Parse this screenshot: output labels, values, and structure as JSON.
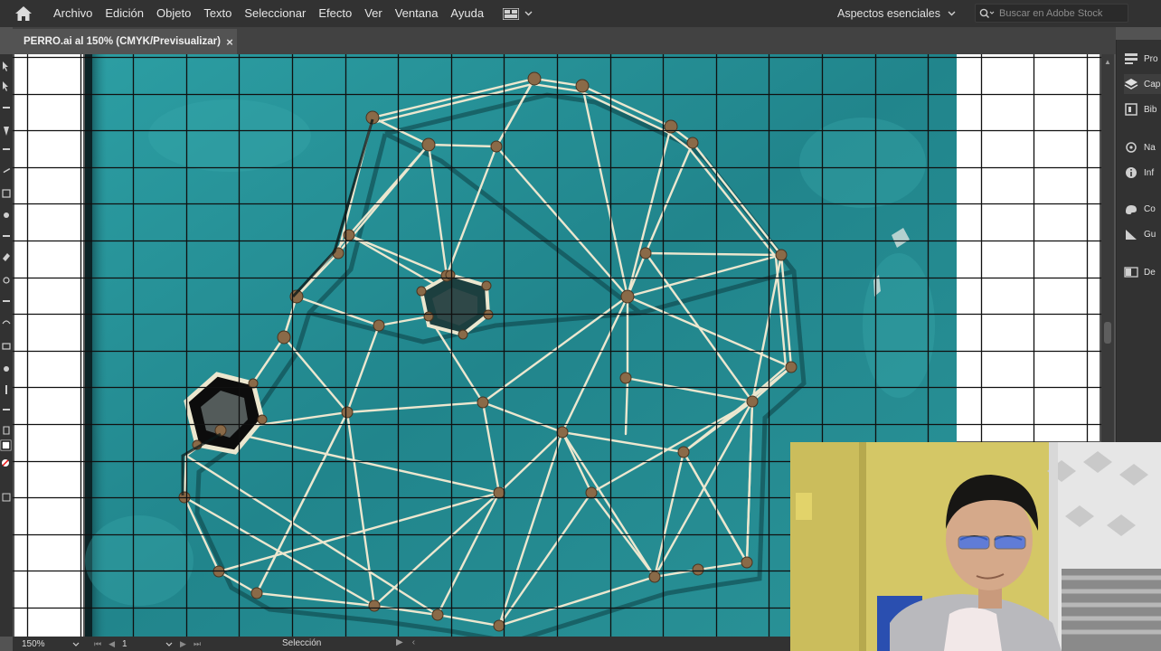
{
  "menubar": {
    "items": [
      "Archivo",
      "Edición",
      "Objeto",
      "Texto",
      "Seleccionar",
      "Efecto",
      "Ver",
      "Ventana",
      "Ayuda"
    ],
    "workspace": "Aspectos esenciales",
    "search_placeholder": "Buscar en Adobe Stock"
  },
  "document": {
    "tab_title": "PERRO.ai al 150% (CMYK/Previsualizar)",
    "close_glyph": "×"
  },
  "right_panel": {
    "items": [
      "Pro",
      "Cap",
      "Bib",
      "Na",
      "Inf",
      "Co",
      "Gu",
      "De"
    ]
  },
  "statusbar": {
    "zoom": "150%",
    "artboard_number": "1",
    "tool_status": "Selección"
  },
  "colors": {
    "ui_dark": "#323232",
    "ui_mid": "#535353",
    "photo_teal": "#2a9aa0",
    "grid_line": "#101010",
    "string": "#e9e4cc",
    "nail": "#7a5a3a"
  }
}
